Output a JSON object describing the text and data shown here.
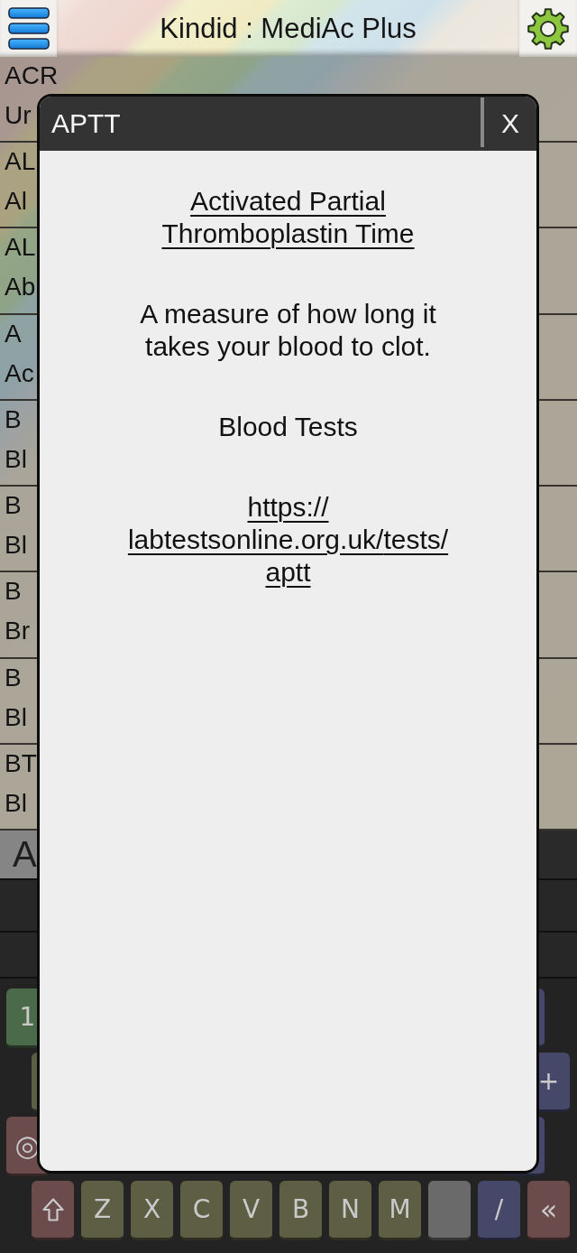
{
  "top_bar": {
    "title": "Kindid : MediAc Plus"
  },
  "list": {
    "rows": [
      {
        "title": "ACR",
        "subtitle": "Ur"
      },
      {
        "title": "AL",
        "subtitle": "Al"
      },
      {
        "title": "AL",
        "subtitle": "Ab"
      },
      {
        "title": "A",
        "subtitle": "Ac"
      },
      {
        "title": "B",
        "subtitle": "Bl"
      },
      {
        "title": "B",
        "subtitle": "Bl"
      },
      {
        "title": "B",
        "subtitle": "Br"
      },
      {
        "title": "B",
        "subtitle": "Bl"
      },
      {
        "title": "BT",
        "subtitle": "Bl"
      }
    ]
  },
  "search": {
    "value": "A"
  },
  "keyboard": {
    "rows": [
      {
        "keys": [
          {
            "kind": "digit",
            "label": "1"
          },
          {
            "kind": "operator"
          }
        ]
      },
      {
        "keys": [
          {
            "kind": "letter"
          },
          {
            "kind": "operator",
            "label": "+"
          }
        ]
      },
      {
        "keys": [
          {
            "kind": "function",
            "label": "◎"
          },
          {
            "kind": "operator"
          }
        ]
      },
      {
        "keys": [
          {
            "kind": "shift"
          },
          {
            "kind": "letter",
            "label": "Z"
          },
          {
            "kind": "letter",
            "label": "X"
          },
          {
            "kind": "letter",
            "label": "C"
          },
          {
            "kind": "letter",
            "label": "V"
          },
          {
            "kind": "letter",
            "label": "B"
          },
          {
            "kind": "letter",
            "label": "N"
          },
          {
            "kind": "letter",
            "label": "M"
          },
          {
            "kind": "blank"
          },
          {
            "kind": "operator",
            "label": "/"
          },
          {
            "kind": "function",
            "label": "«"
          }
        ]
      }
    ]
  },
  "dialog": {
    "title": "APTT",
    "close_label": "X",
    "heading": "Activated Partial Thromboplastin Time",
    "description": "A measure of how long it takes your blood to clot.",
    "category": "Blood Tests",
    "link": "https://labtestsonline.org.uk/tests/aptt"
  }
}
